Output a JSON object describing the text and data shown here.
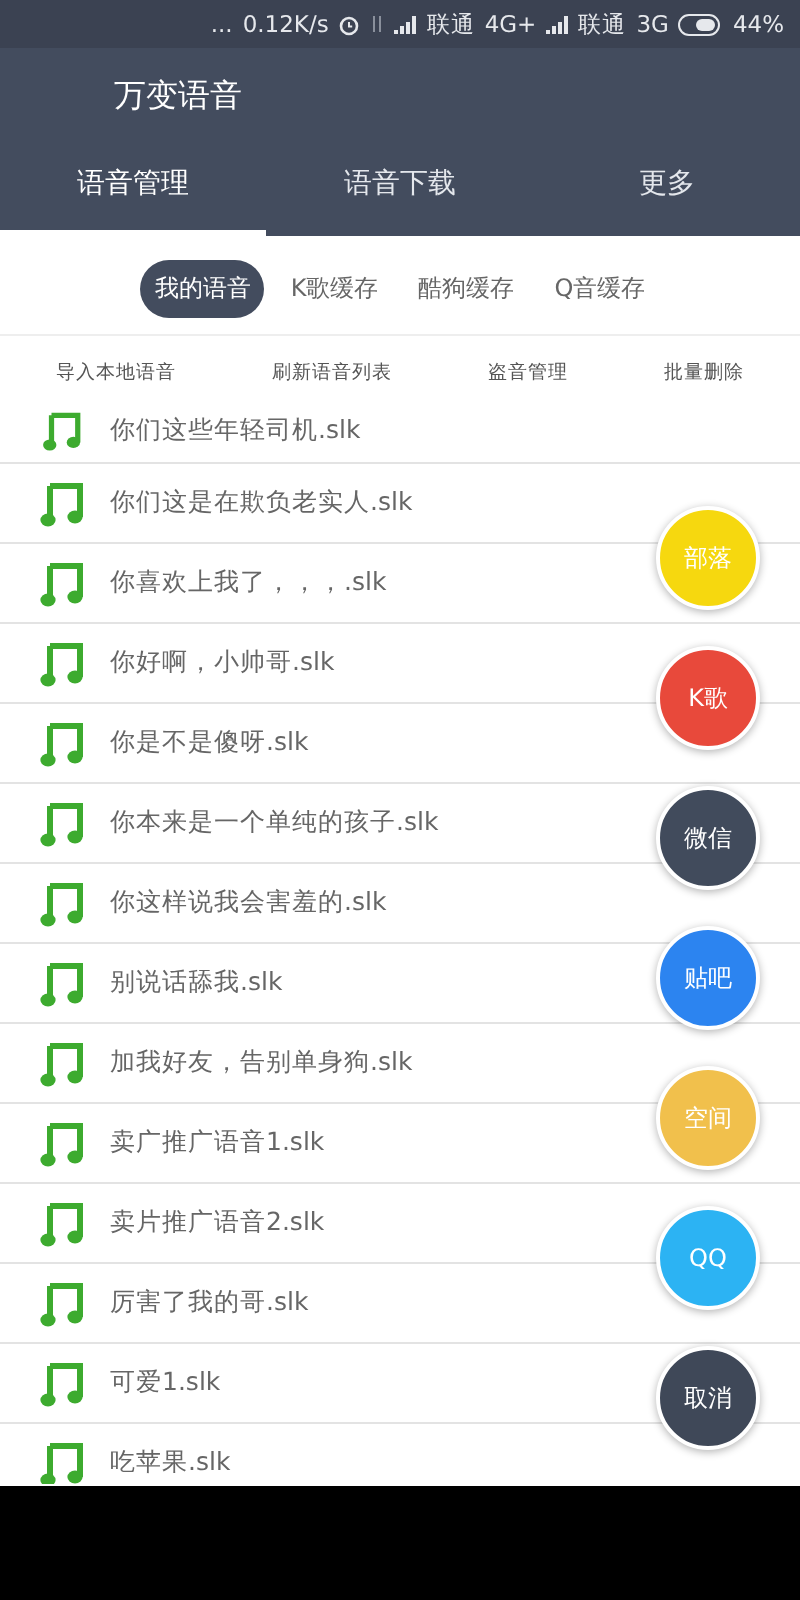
{
  "status_bar": {
    "notifications": "...",
    "speed": "0.12K/s",
    "carriers": [
      {
        "name": "联通",
        "network": "4G+"
      },
      {
        "name": "联通",
        "network": "3G"
      }
    ],
    "battery": "44%"
  },
  "app_bar": {
    "title": "万变语音"
  },
  "tabs": [
    {
      "label": "语音管理",
      "selected": true
    },
    {
      "label": "语音下载",
      "selected": false
    },
    {
      "label": "更多",
      "selected": false
    }
  ],
  "filters": [
    {
      "label": "我的语音",
      "selected": true
    },
    {
      "label": "K歌缓存",
      "selected": false
    },
    {
      "label": "酷狗缓存",
      "selected": false
    },
    {
      "label": "Q音缓存",
      "selected": false
    }
  ],
  "actions": [
    "导入本地语音",
    "刷新语音列表",
    "盗音管理",
    "批量删除"
  ],
  "files": [
    "你们这些年轻司机.slk",
    "你们这是在欺负老实人.slk",
    "你喜欢上我了，，，.slk",
    "你好啊，小帅哥.slk",
    "你是不是傻呀.slk",
    "你本来是一个单纯的孩子.slk",
    "你这样说我会害羞的.slk",
    "别说话舔我.slk",
    "加我好友，告别单身狗.slk",
    "卖广推广语音1.slk",
    "卖片推广语音2.slk",
    "厉害了我的哥.slk",
    "可爱1.slk",
    "吃苹果.slk"
  ],
  "share_menu": [
    {
      "label": "部落",
      "color": "#f6d80f"
    },
    {
      "label": "K歌",
      "color": "#e8493b"
    },
    {
      "label": "微信",
      "color": "#414b5c"
    },
    {
      "label": "贴吧",
      "color": "#2c84f0"
    },
    {
      "label": "空间",
      "color": "#f1c04c"
    },
    {
      "label": "QQ",
      "color": "#2cb3f3"
    },
    {
      "label": "取消",
      "color": "#3f4858"
    }
  ]
}
